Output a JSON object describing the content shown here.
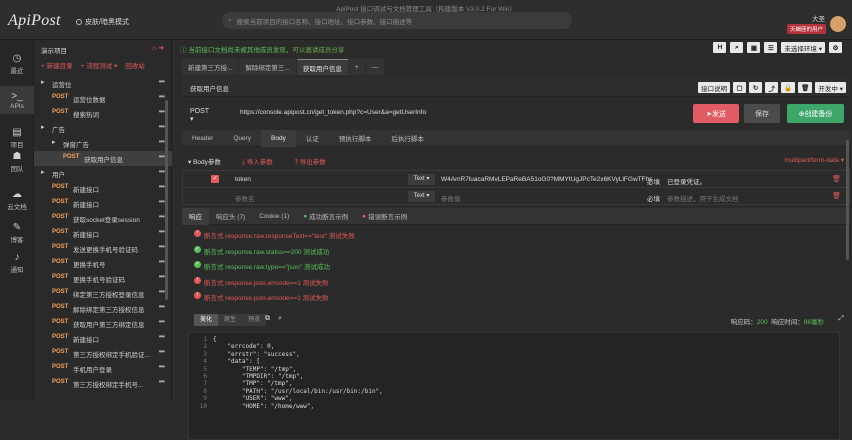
{
  "titlebar": {
    "logo": "ApiPost",
    "skin_label": "皮肤/暗黑模式",
    "window_title": "ApiPost 接口调试与文档管理工具（构建版本 V3.0.2 For Win）",
    "search_placeholder": "搜索当前项目的接口名称、接口地址、接口参数、接口描述等",
    "user_name": "大圣",
    "vip_label": "天蝎座的用户"
  },
  "sidebar": {
    "items": [
      {
        "icon": "clock-icon",
        "glyph": "◷",
        "label": "最近"
      },
      {
        "icon": "terminal-icon",
        "glyph": ">_",
        "label": "APIs"
      },
      {
        "icon": "project-icon",
        "glyph": "▤",
        "label": "项目"
      },
      {
        "icon": "team-icon",
        "glyph": "☗",
        "label": "团队"
      },
      {
        "icon": "cloud-icon",
        "glyph": "☁",
        "label": "云文档"
      },
      {
        "icon": "blog-icon",
        "glyph": "✎",
        "label": "博客"
      },
      {
        "icon": "bell-icon",
        "glyph": "♪",
        "label": "通知"
      }
    ]
  },
  "tree": {
    "project_name": "演示项目",
    "tools": [
      "+ 新建目录",
      "+ 流程测试 ▾",
      "回收站"
    ],
    "rows": [
      {
        "type": "folder",
        "indent": 0,
        "label": "运营位"
      },
      {
        "type": "api",
        "indent": 1,
        "method": "POST",
        "label": "运营位数据"
      },
      {
        "type": "api",
        "indent": 1,
        "method": "POST",
        "label": "搜索热词"
      },
      {
        "type": "folder",
        "indent": 0,
        "label": "广告"
      },
      {
        "type": "folder",
        "indent": 1,
        "label": "弹窗广告"
      },
      {
        "type": "api",
        "indent": 2,
        "method": "POST",
        "label": "获取用户信息",
        "selected": true
      },
      {
        "type": "folder",
        "indent": 0,
        "label": "用户"
      },
      {
        "type": "api",
        "indent": 1,
        "method": "POST",
        "label": "新建接口"
      },
      {
        "type": "api",
        "indent": 1,
        "method": "POST",
        "label": "新建接口"
      },
      {
        "type": "api",
        "indent": 1,
        "method": "POST",
        "label": "获取socket登录session"
      },
      {
        "type": "api",
        "indent": 1,
        "method": "POST",
        "label": "新建接口"
      },
      {
        "type": "api",
        "indent": 1,
        "method": "POST",
        "label": "发送更换手机号验证码"
      },
      {
        "type": "api",
        "indent": 1,
        "method": "POST",
        "label": "更换手机号"
      },
      {
        "type": "api",
        "indent": 1,
        "method": "POST",
        "label": "更换手机号验证码"
      },
      {
        "type": "api",
        "indent": 1,
        "method": "POST",
        "label": "绑定第三方授权登录信息"
      },
      {
        "type": "api",
        "indent": 1,
        "method": "POST",
        "label": "解除绑定第三方授权信息"
      },
      {
        "type": "api",
        "indent": 1,
        "method": "POST",
        "label": "获取用户第三方绑定信息"
      },
      {
        "type": "api",
        "indent": 1,
        "method": "POST",
        "label": "新建接口"
      },
      {
        "type": "api",
        "indent": 1,
        "method": "POST",
        "label": "第三方授权绑定手机验证..."
      },
      {
        "type": "api",
        "indent": 1,
        "method": "POST",
        "label": "手机用户登录"
      },
      {
        "type": "api",
        "indent": 1,
        "method": "POST",
        "label": "第三方授权绑定手机号..."
      }
    ]
  },
  "main": {
    "notice": "当前接口文档尚未被其他成员发现，",
    "notice_link": "可以邀请成员分享",
    "top_buttons": [
      "H",
      "⌕",
      "▣",
      "☰"
    ],
    "env_label": "未选择环境 ▾",
    "tabs": [
      "新建第三方授...",
      "解除绑定第三...",
      "获取用户信息"
    ],
    "api_name": "获取用户信息",
    "api_actions": [
      "接口说明",
      "▢",
      "↻",
      "⤴",
      "🔒",
      "🗑",
      "开发中 ▾"
    ],
    "method": "POST ▾",
    "url": "https://console.apipost.cn/get_token.php?c=User&a=getUserInfo",
    "send_label": "发送",
    "save_label": "保存",
    "mock_label": "创建备份",
    "request_tabs": [
      "Header",
      "Query",
      "Body",
      "认证",
      "预执行脚本",
      "后执行脚本"
    ],
    "body_label": "Body参数",
    "import_label": "导入参数",
    "export_label": "导出参数",
    "content_type": "multipart/form-data",
    "params": [
      {
        "key": "token",
        "type": "Text ▾",
        "value": "W4AmR7luacaRMvLEPaReBA51oG0?MMYtUgJPcTe2x6KVyLlFGwTFhs",
        "required": "必填",
        "desc": "已登录凭证。"
      },
      {
        "key": "参数名",
        "type": "Text ▾",
        "value": "参数值",
        "required": "必填",
        "desc": "参数描述，用于生成文档",
        "placeholder": true
      }
    ],
    "response_tabs": [
      "响应",
      "响应头 (7)",
      "Cookie (1)",
      "成功断言示例",
      "错误断言示例"
    ],
    "assertions": [
      {
        "status": "fail",
        "text": "断言式 response.raw.responseText==\"test\" 测试失败"
      },
      {
        "status": "pass",
        "text": "断言式 response.raw.status==200 测试成功"
      },
      {
        "status": "pass",
        "text": "断言式 response.raw.type==\"json\" 测试成功"
      },
      {
        "status": "fail",
        "text": "断言式 response.json.errcode==1 测试失败"
      },
      {
        "status": "fail",
        "text": "断言式 response.json.errcode==1 测试失败"
      }
    ],
    "view_modes": [
      "美化",
      "原生",
      "预览"
    ],
    "resp_time_label": "响应码：",
    "resp_code": "200",
    "time_label": "响应时间：",
    "time_value": "96毫秒",
    "code_lines": [
      {
        "n": "1",
        "t": "{"
      },
      {
        "n": "2",
        "t": "    \"errcode\": 0,"
      },
      {
        "n": "3",
        "t": "    \"errstr\": \"success\","
      },
      {
        "n": "4",
        "t": "    \"data\": ["
      },
      {
        "n": "5",
        "t": "        \"TEMP\": \"/tmp\","
      },
      {
        "n": "6",
        "t": "        \"TMPDIR\": \"/tmp\","
      },
      {
        "n": "7",
        "t": "        \"TMP\": \"/tmp\","
      },
      {
        "n": "8",
        "t": "        \"PATH\": \"/usr/local/bin:/usr/bin:/bin\","
      },
      {
        "n": "9",
        "t": "        \"USER\": \"www\","
      },
      {
        "n": "10",
        "t": "        \"HOME\": \"/home/www\","
      }
    ]
  }
}
